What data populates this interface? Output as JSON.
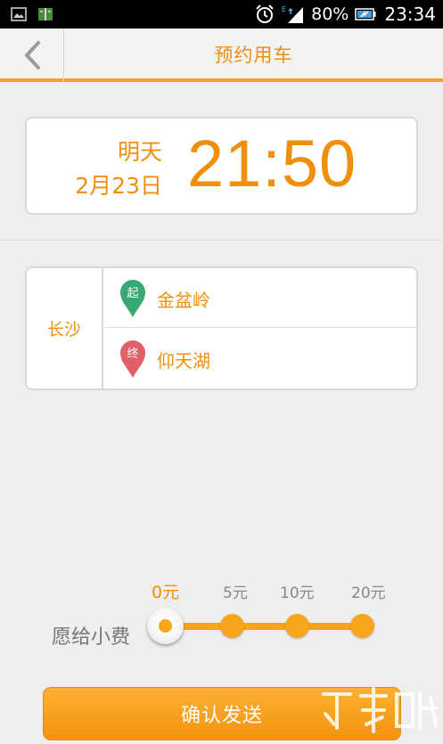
{
  "status_bar": {
    "icons": [
      "picture-icon",
      "book-icon",
      "alarm-icon",
      "signal-icon",
      "battery-icon"
    ],
    "battery": "80%",
    "time": "23:34"
  },
  "header": {
    "title": "预约用车",
    "back_icon": "chevron-left-icon"
  },
  "pickup_time": {
    "day": "明天",
    "date": "2月23日",
    "clock": "21:50"
  },
  "route": {
    "city": "长沙",
    "start": {
      "tag": "起",
      "place": "金盆岭",
      "pin_color": "#3aa872"
    },
    "end": {
      "tag": "终",
      "place": "仰天湖",
      "pin_color": "#e0606a"
    }
  },
  "tip": {
    "label": "愿给小费",
    "options": [
      "0元",
      "5元",
      "10元",
      "20元"
    ],
    "selected_index": 0
  },
  "confirm": {
    "label": "确认发送"
  },
  "colors": {
    "accent": "#f08e0e",
    "background": "#eeeeee"
  }
}
